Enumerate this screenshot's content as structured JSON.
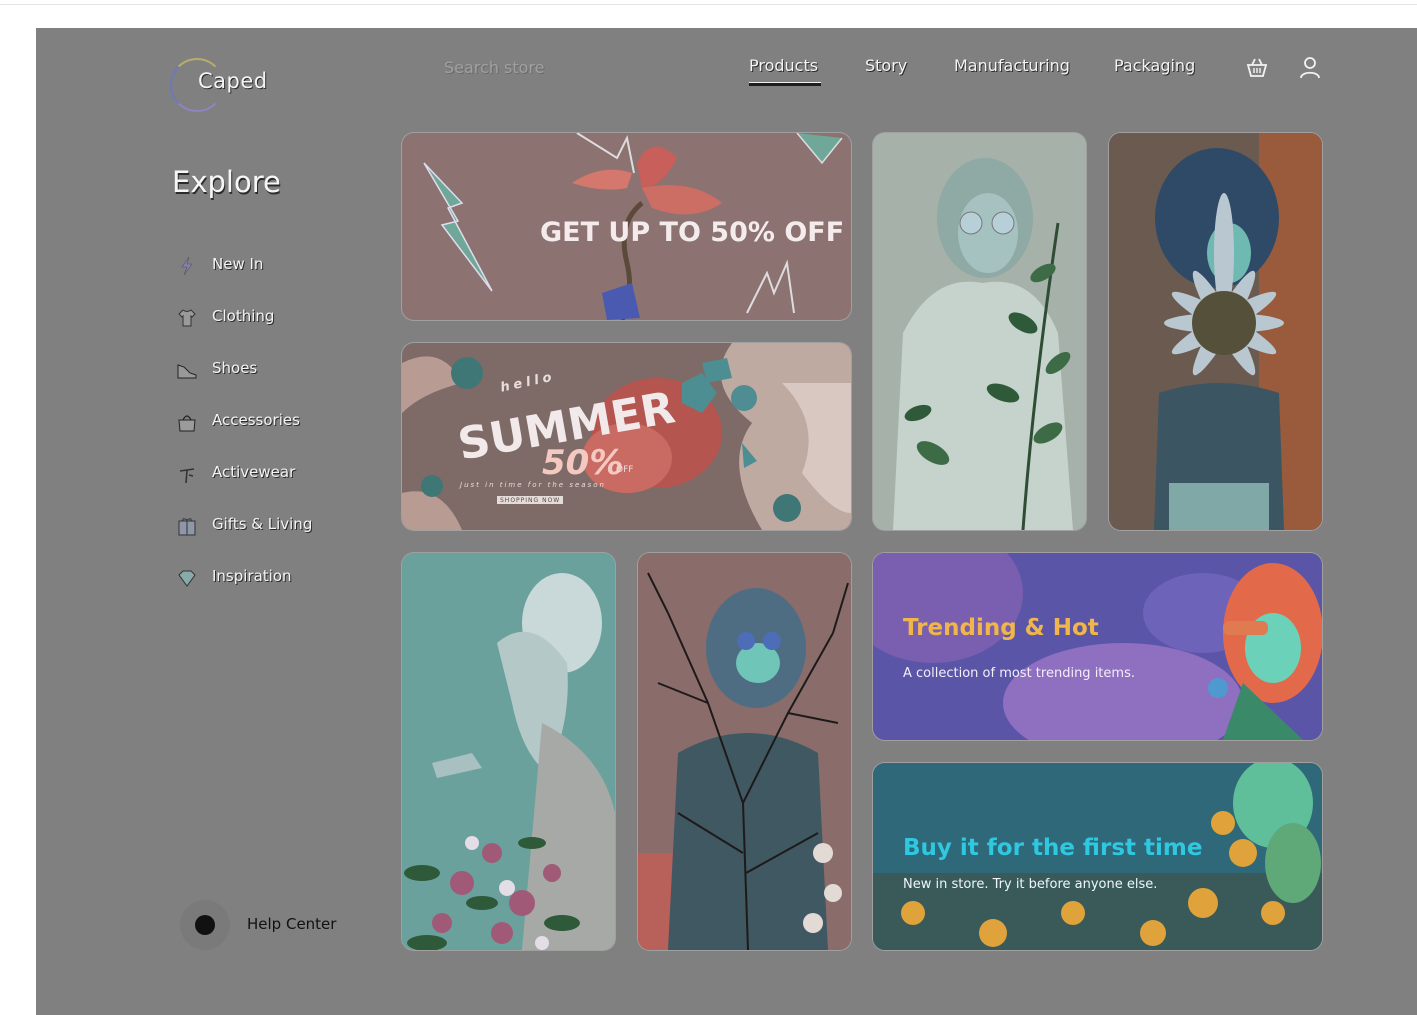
{
  "brand": {
    "logo_text": "Caped"
  },
  "header": {
    "search_placeholder": "Search store",
    "nav": [
      "Products",
      "Story",
      "Manufacturing",
      "Packaging"
    ],
    "active_nav": "Products"
  },
  "sidebar": {
    "title": "Explore",
    "items": [
      {
        "label": "New In",
        "icon": "lightning-icon"
      },
      {
        "label": "Clothing",
        "icon": "shirt-icon"
      },
      {
        "label": "Shoes",
        "icon": "shoe-icon"
      },
      {
        "label": "Accessories",
        "icon": "bag-icon"
      },
      {
        "label": "Activewear",
        "icon": "activewear-icon"
      },
      {
        "label": "Gifts & Living",
        "icon": "gift-icon"
      },
      {
        "label": "Inspiration",
        "icon": "diamond-icon"
      }
    ],
    "help_label": "Help Center"
  },
  "cards": {
    "sale": {
      "headline": "GET UP TO 50% OFF"
    },
    "summer": {
      "kicker": "hello",
      "title": "SUMMER",
      "percent": "50%",
      "off": "OFF",
      "tagline": "Just in time for the season",
      "button": "SHOPPING NOW"
    },
    "trending": {
      "title": "Trending & Hot",
      "subtitle": "A collection of most trending items."
    },
    "first_time": {
      "title": "Buy it for the first time",
      "subtitle": "New in store. Try it before anyone else."
    }
  },
  "colors": {
    "overlay_gray": "#808080",
    "text_light": "#f4f4f4",
    "trending_title": "#f0b64a",
    "first_time_title": "#2ec8e0"
  }
}
